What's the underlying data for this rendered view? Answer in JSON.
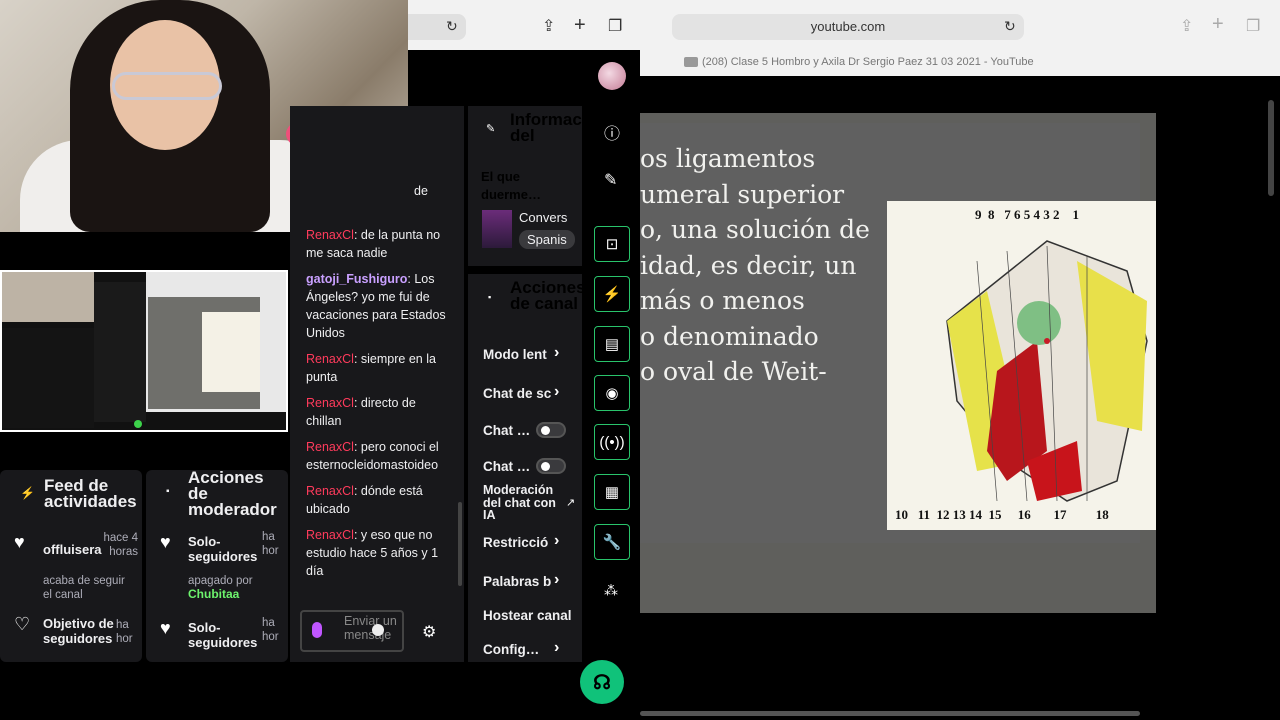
{
  "webcam": {
    "label": "webcam"
  },
  "twitch_chat": {
    "partial_top": "de",
    "messages": [
      {
        "user": "RenaxCl",
        "text": ": de la punta no me saca nadie",
        "style": "red"
      },
      {
        "user": "gatoji_Fushiguro",
        "text": ": Los Ángeles? yo me fui de vacaciones para Estados Unidos",
        "style": "purple"
      },
      {
        "user": "RenaxCl",
        "text": ": siempre en la punta",
        "style": "red"
      },
      {
        "user": "RenaxCl",
        "text": ": directo de chillan",
        "style": "red"
      },
      {
        "user": "RenaxCl",
        "text": ": pero conoci el esternocleidomastoideo",
        "style": "red"
      },
      {
        "user": "RenaxCl",
        "text": ": dónde está ubicado",
        "style": "red"
      },
      {
        "user": "RenaxCl",
        "text": ": y eso que no estudio hace 5 años y 1 día",
        "style": "red"
      }
    ],
    "input_placeholder": "Enviar un mensaje"
  },
  "feed": {
    "title": "Feed de actividades",
    "items": [
      {
        "name": "offluisera",
        "time": "hace 4 horas",
        "desc": "acaba de seguir el canal"
      },
      {
        "name": "Objetivo de seguidores",
        "time": "ha hor",
        "desc": ""
      }
    ]
  },
  "mod_actions": {
    "title": "Acciones de moderador",
    "items": [
      {
        "name": "Solo-seguidores",
        "time": "ha hor",
        "desc": "apagado por",
        "by": "Chubitaa"
      },
      {
        "name": "Solo-seguidores",
        "time": "ha hor",
        "desc": "",
        "by": ""
      }
    ]
  },
  "stream_info": {
    "title": "Información del stream",
    "stream_title": "El que duerme…",
    "category": "Convers",
    "language": "Spanis"
  },
  "channel_actions": {
    "title": "Acciones de canal",
    "rows": [
      {
        "label": "Modo lent",
        "control": "chevron"
      },
      {
        "label": "Chat de sc",
        "control": "chevron"
      },
      {
        "label": "Chat …",
        "control": "toggle"
      },
      {
        "label": "Chat …",
        "control": "toggle"
      },
      {
        "label": "Moderación del chat con IA",
        "control": "external"
      },
      {
        "label": "Restricció",
        "control": "chevron"
      },
      {
        "label": "Palabras b",
        "control": "chevron"
      },
      {
        "label": "Hostear canal",
        "control": "none"
      },
      {
        "label": "Config…",
        "control": "chevron"
      }
    ]
  },
  "youtube": {
    "url": "youtube.com",
    "tab_title": "(208) Clase 5 Hombro y Axila Dr Sergio Paez 31 03 2021 - YouTube",
    "slide_text": "os ligamentos\numeral superior\no, una solución de\nidad, es decir, un\nmás o menos\no denominado\no oval de Weit-",
    "top_numbers": "9  8   7 6 5 4 3 2    1",
    "bottom_numbers": "10   11  12 13 14  15     16       17         18"
  },
  "colors": {
    "accent_green": "#29c46b",
    "chat_red": "#ff3b5c",
    "chat_purple": "#c9a0ff",
    "link_green": "#6df36d"
  }
}
